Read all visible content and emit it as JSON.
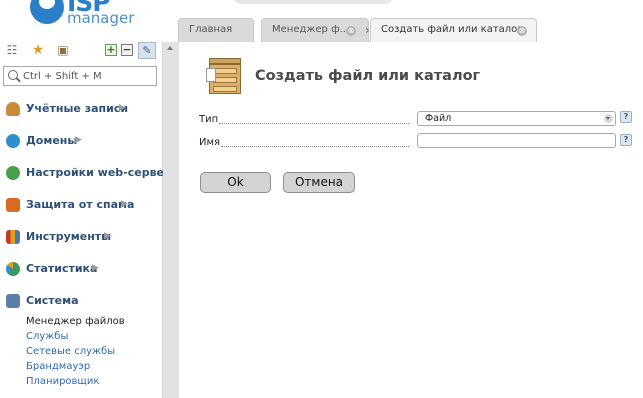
{
  "header": {
    "logo_brand": "ISP",
    "logo_sub": "manager"
  },
  "tabs": [
    {
      "label": "Главная"
    },
    {
      "label": "Менеджер ф...",
      "close": "⊗"
    },
    {
      "label": "Создать файл или каталог",
      "close": "⊗",
      "arrow": "›"
    }
  ],
  "sidebar": {
    "search_placeholder": "Ctrl + Shift + M",
    "sections": [
      {
        "label": "Учётные записи",
        "icon": "users-icon",
        "color": "#c98b3a"
      },
      {
        "label": "Домены",
        "icon": "globe-icon",
        "color": "#2e8fd0"
      },
      {
        "label": "Настройки web-серве...",
        "icon": "web-settings-icon",
        "color": "#4aa04a"
      },
      {
        "label": "Защита от спама",
        "icon": "shield-icon",
        "color": "#d86a22"
      },
      {
        "label": "Инструменты",
        "icon": "tools-icon",
        "color": "#c0392b"
      },
      {
        "label": "Статистика",
        "icon": "stats-icon",
        "color": "#3a9a5a"
      },
      {
        "label": "Система",
        "icon": "system-icon",
        "color": "#5a7fa8"
      }
    ],
    "system_items": [
      {
        "label": "Менеджер файлов",
        "current": true
      },
      {
        "label": "Службы"
      },
      {
        "label": "Сетевые службы"
      },
      {
        "label": "Брандмауэр"
      },
      {
        "label": "Планировщик"
      }
    ]
  },
  "main": {
    "title": "Создать файл или каталог",
    "fields": {
      "type_label": "Тип",
      "type_value": "Файл",
      "name_label": "Имя",
      "name_value": "",
      "help": "?"
    },
    "buttons": {
      "ok": "Ok",
      "cancel": "Отмена"
    }
  }
}
